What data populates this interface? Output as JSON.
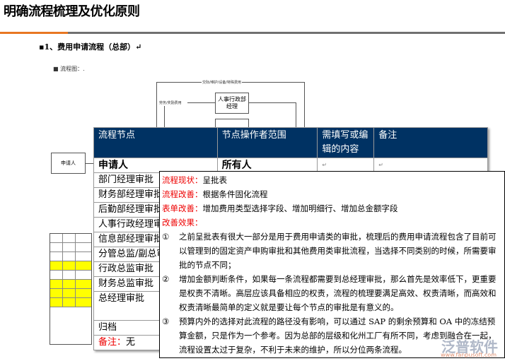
{
  "title": "明确流程梳理及优化原则",
  "section": "▪1、费用申请流程（总部）↵",
  "flow_label": "■   流程图：.",
  "flowchart": {
    "top_label": "交际/维护/设备/特殊费用",
    "side_label": "劳务/奖励费用",
    "box_hr": "人事行政部经理",
    "box_applicant": "申请人"
  },
  "table": {
    "headers": [
      "流程节点",
      "节点操作者范围",
      "需填写或编辑的内容",
      "备注"
    ],
    "rows": [
      [
        "申请人",
        "所有人",
        "↵",
        "↵"
      ],
      [
        "部门经理审批"
      ],
      [
        "财务部经理审批"
      ],
      [
        "后勤部经理审批"
      ],
      [
        "人事行政经理审批"
      ],
      [
        "信息部经理审批"
      ],
      [
        "分管总监/副总审批"
      ],
      [
        "行政总监审批"
      ],
      [
        "财务总监审批"
      ],
      [
        "总经理审批"
      ],
      [
        "归档"
      ]
    ],
    "note_label": "备注：",
    "note_value": "无"
  },
  "popup": {
    "status_label": "流程现状：",
    "status": "呈批表",
    "improve_label": "流程改善：",
    "improve": "根据条件固化流程",
    "form_label": "表单改善：",
    "form": "增加费用类型选择字段、增加明细行、增加总金额字段",
    "effect_label": "改善效果：",
    "items": [
      {
        "num": "①",
        "text": "之前呈批表有很大一部分是用于费用申请类的审批，梳理后的费用申请流程包含了目前可以管理到的固定资产申购审批和其他费用类审批流程，当选择不同类别的时候，所需要审批的节点不同；"
      },
      {
        "num": "②",
        "text": "增加金额判断条件，如果每一条流程都需要到总经理审批，那么首先是效率低下，更重要是权责不清晰。高层应该具备相应的权责，流程的梳理要满足高效、权责清晰，而高效和权责清晰最简单的定义就是要让每个节点的审批是有意义的。"
      },
      {
        "num": "③",
        "text": "预算内外的选择对此流程的路径没有影响，可以通过 SAP 的剩余预算和 OA 中的冻结预算金额，只是作为一个参考。因为总部的层级和化州工厂有所不同，考虑到融合在一起，流程设置太过于复杂，不利于未来的维护，所以分位两条流程。"
      }
    ]
  },
  "watermark": {
    "name": "泛普软件",
    "url": "www.fanpusoft.com"
  }
}
